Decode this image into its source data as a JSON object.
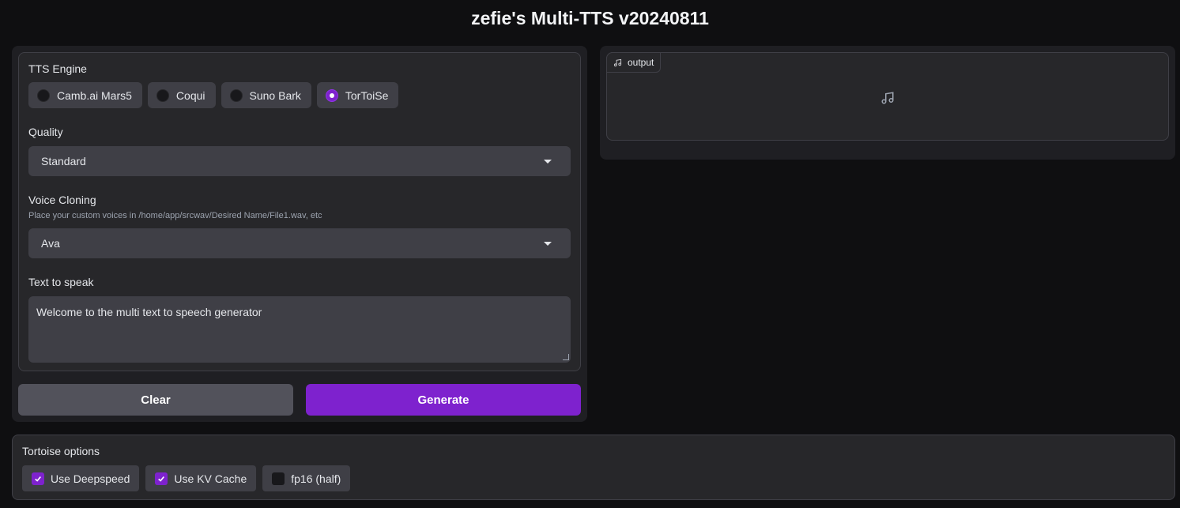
{
  "app": {
    "title": "zefie's Multi-TTS v20240811"
  },
  "engine": {
    "label": "TTS Engine",
    "options": [
      {
        "label": "Camb.ai Mars5",
        "checked": false
      },
      {
        "label": "Coqui",
        "checked": false
      },
      {
        "label": "Suno Bark",
        "checked": false
      },
      {
        "label": "TorToiSe",
        "checked": true
      }
    ]
  },
  "quality": {
    "label": "Quality",
    "value": "Standard"
  },
  "voice": {
    "label": "Voice Cloning",
    "info": "Place your custom voices in /home/app/srcwav/Desired Name/File1.wav, etc",
    "value": "Ava"
  },
  "text": {
    "label": "Text to speak",
    "value": "Welcome to the multi text to speech generator"
  },
  "buttons": {
    "clear": "Clear",
    "generate": "Generate"
  },
  "output": {
    "label": "output",
    "icon": "music-note-icon"
  },
  "tortoise": {
    "label": "Tortoise options",
    "options": [
      {
        "label": "Use Deepspeed",
        "checked": true
      },
      {
        "label": "Use KV Cache",
        "checked": true
      },
      {
        "label": "fp16 (half)",
        "checked": false
      }
    ]
  },
  "colors": {
    "accent": "#7e22ce",
    "background": "#0f0f11",
    "panel": "#27272a"
  }
}
